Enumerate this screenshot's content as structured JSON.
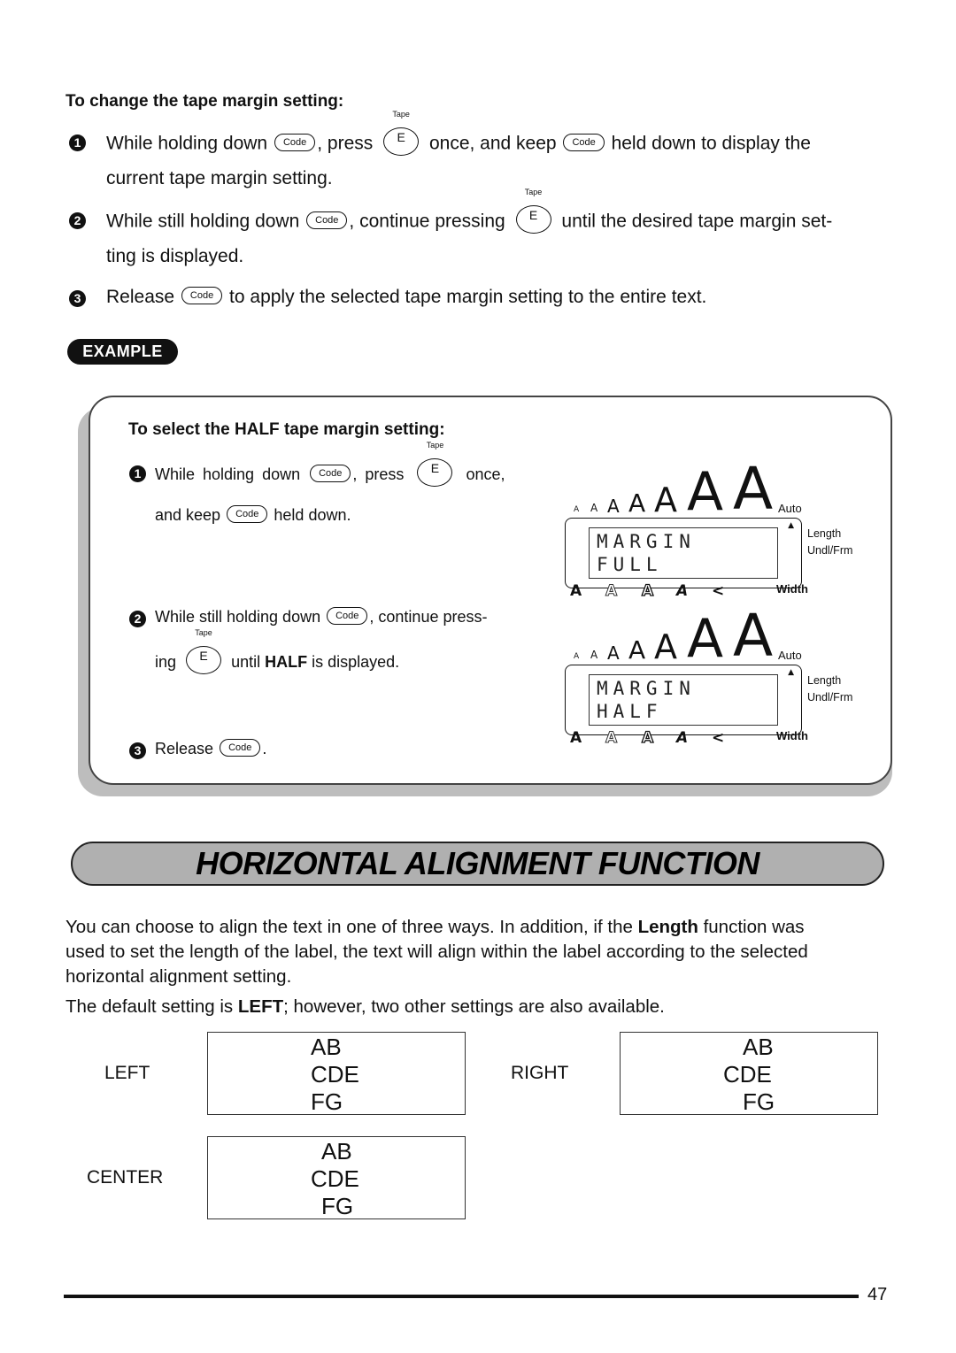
{
  "section1": {
    "heading": "To change the tape margin setting:",
    "key_code_label": "Code",
    "key_e_label": "E",
    "key_e_caption": "Tape",
    "steps": [
      {
        "num": "1",
        "a": "While holding down",
        "b": ", press",
        "c": "once, and keep",
        "d": "held down to display the",
        "e": "current tape margin setting."
      },
      {
        "num": "2",
        "a": "While still holding down",
        "b": ", continue pressing",
        "c": "until the desired tape margin set-",
        "d": "ting is displayed."
      },
      {
        "num": "3",
        "a": "Release",
        "b": "to apply the selected tape margin setting to the entire text."
      }
    ]
  },
  "example": {
    "badge": "EXAMPLE",
    "heading": "To select the HALF tape margin setting:",
    "steps": [
      {
        "num": "1",
        "a": "While holding down",
        "b": ", press",
        "c": "once,",
        "d": "and keep",
        "e": "held down."
      },
      {
        "num": "2",
        "a": "While still holding down",
        "b": ", continue press-",
        "c": "ing",
        "d": "until",
        "bold": "HALF",
        "e": "is displayed."
      },
      {
        "num": "3",
        "a": "Release",
        "b": "."
      }
    ],
    "displays": [
      {
        "line1": "MARGIN",
        "line2": "FULL"
      },
      {
        "line1": "MARGIN",
        "line2": "HALF"
      }
    ],
    "lcd_labels": {
      "auto": "Auto",
      "length": "Length",
      "undl": "Undl/Frm",
      "width": "Width",
      "size_glyph": "A",
      "style_glyphs": [
        "A",
        "A",
        "A",
        "A",
        "<"
      ]
    }
  },
  "section2": {
    "title": "HORIZONTAL ALIGNMENT FUNCTION",
    "para1_a": "You can choose to align the text in one of three ways. In addition, if the ",
    "para1_bold": "Length",
    "para1_b": " function was",
    "para1_line2": "used to set the length of the label, the text will align within the label according to the selected",
    "para1_line3": "horizontal alignment setting.",
    "para2_a": "The default setting is ",
    "para2_bold": "LEFT",
    "para2_b": "; however, two other settings are also available.",
    "alignments": [
      {
        "label": "LEFT",
        "lines": [
          "AB",
          "CDE",
          "FG"
        ]
      },
      {
        "label": "RIGHT",
        "lines": [
          "AB",
          "CDE",
          "FG"
        ]
      },
      {
        "label": "CENTER",
        "lines": [
          "AB",
          "CDE",
          "FG"
        ]
      }
    ]
  },
  "footer": {
    "page_number": "47"
  }
}
